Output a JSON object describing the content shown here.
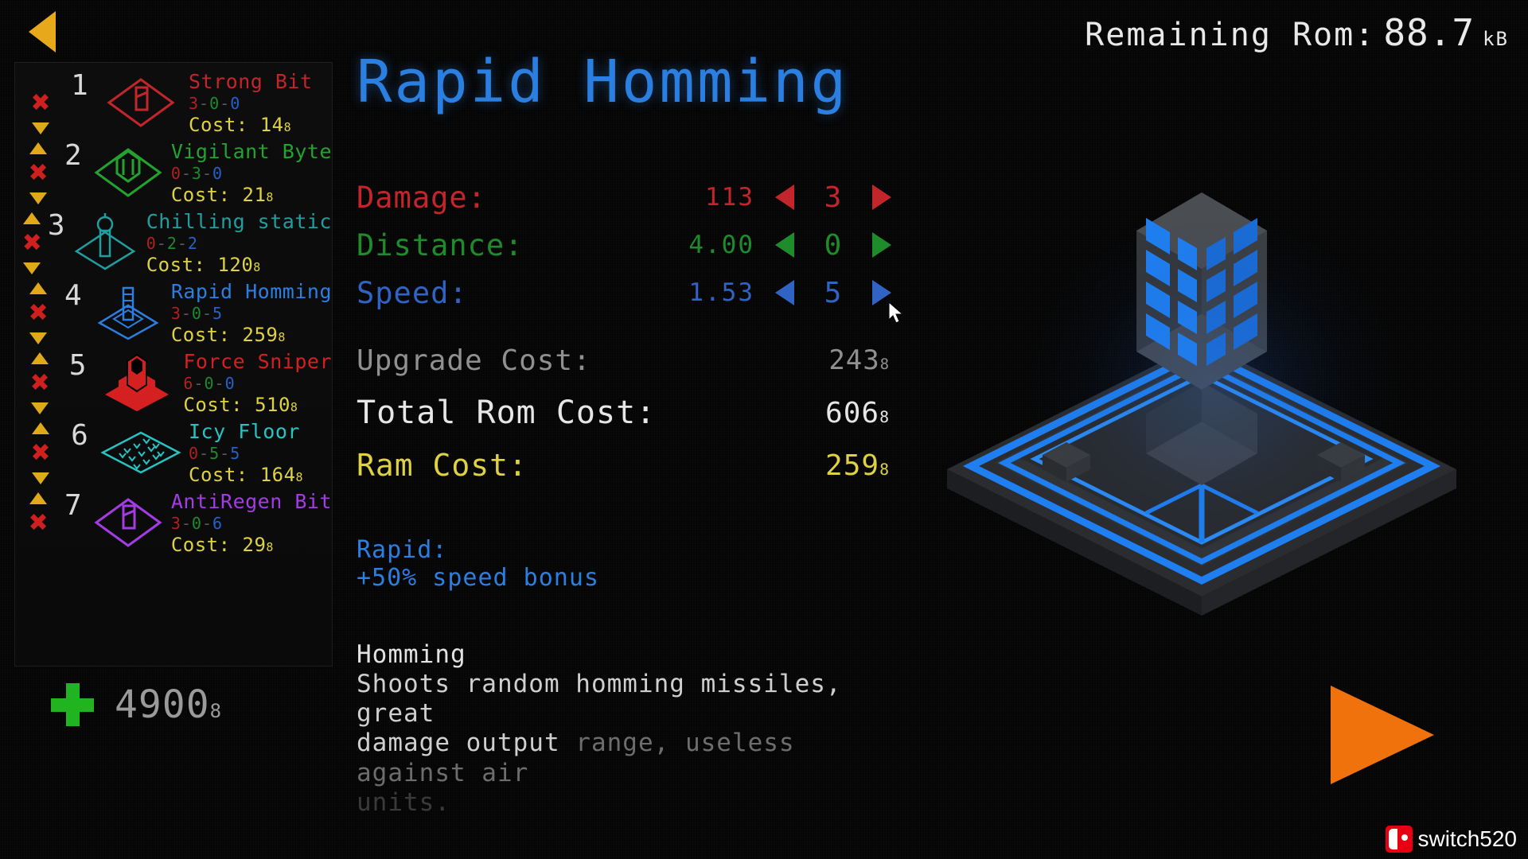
{
  "header": {
    "back_icon": "back-triangle-icon",
    "rom_label": "Remaining Rom:",
    "rom_value": "88.7",
    "rom_unit": "kB"
  },
  "sidebar": {
    "towers": [
      {
        "index": "1",
        "name": "Strong Bit",
        "color": "#c2262a",
        "dmg": "3",
        "rng": "0",
        "spd": "0",
        "cost": "14",
        "cost_sub": "8",
        "icon": "bit-diamond-icon"
      },
      {
        "index": "2",
        "name": "Vigilant Byte",
        "color": "#23a32e",
        "dmg": "0",
        "rng": "3",
        "spd": "0",
        "cost": "21",
        "cost_sub": "8",
        "icon": "byte-diamond-icon"
      },
      {
        "index": "3",
        "name": "Chilling static",
        "color": "#1f9f9f",
        "dmg": "0",
        "rng": "2",
        "spd": "2",
        "cost": "120",
        "cost_sub": "8",
        "icon": "static-tower-icon"
      },
      {
        "index": "4",
        "name": "Rapid Homming",
        "color": "#2b7fe0",
        "dmg": "3",
        "rng": "0",
        "spd": "5",
        "cost": "259",
        "cost_sub": "8",
        "icon": "homming-tower-icon"
      },
      {
        "index": "5",
        "name": "Force Sniper",
        "color": "#d42020",
        "dmg": "6",
        "rng": "0",
        "spd": "0",
        "cost": "510",
        "cost_sub": "8",
        "icon": "sniper-tower-icon"
      },
      {
        "index": "6",
        "name": "Icy Floor",
        "color": "#28c2c2",
        "dmg": "0",
        "rng": "5",
        "spd": "5",
        "cost": "164",
        "cost_sub": "8",
        "icon": "icy-floor-icon"
      },
      {
        "index": "7",
        "name": "AntiRegen Bit",
        "color": "#a43ce6",
        "dmg": "3",
        "rng": "0",
        "spd": "6",
        "cost": "29",
        "cost_sub": "8",
        "icon": "antiregen-diamond-icon"
      }
    ],
    "move_up_icon": "triangle-up-icon",
    "move_down_icon": "triangle-down-icon",
    "remove_icon": "x-close-icon",
    "total": {
      "add_icon": "plus-icon",
      "value": "4900",
      "sub": "8"
    }
  },
  "main": {
    "title": "Rapid Homming",
    "stats": [
      {
        "label": "Damage:",
        "value": "113",
        "level": "3",
        "color": "#c2262a",
        "dec_icon": "arrow-left-icon",
        "inc_icon": "arrow-right-icon"
      },
      {
        "label": "Distance:",
        "value": "4.00",
        "level": "0",
        "color": "#1e8c2a",
        "dec_icon": "arrow-left-icon",
        "inc_icon": "arrow-right-icon"
      },
      {
        "label": "Speed:",
        "value": "1.53",
        "level": "5",
        "color": "#2f63c4",
        "dec_icon": "arrow-left-icon",
        "inc_icon": "arrow-right-icon"
      }
    ],
    "costs": {
      "upgrade_label": "Upgrade Cost:",
      "upgrade_value": "243",
      "upgrade_sub": "8",
      "total_label": "Total Rom Cost:",
      "total_value": "606",
      "total_sub": "8",
      "ram_label": "Ram Cost:",
      "ram_value": "259",
      "ram_sub": "8"
    },
    "bonus": {
      "title": "Rapid:",
      "text": "+50% speed bonus"
    },
    "description": {
      "title": "Homming",
      "line1": "Shoots random homming missiles, great",
      "line2": "damage output",
      "line2_faded": " range, useless against air",
      "line3_faded": "units."
    }
  },
  "preview": {
    "model_icon": "isometric-tower-preview"
  },
  "footer": {
    "next_icon": "play-next-triangle-icon",
    "cursor_icon": "mouse-pointer-icon",
    "watermark_text": "switch520",
    "watermark_logo": "switch-logo-icon"
  },
  "colors": {
    "accent_blue": "#2b7fe0",
    "accent_orange": "#f0720c",
    "accent_yellow": "#ded243",
    "accent_green": "#1e8c2a",
    "accent_red": "#c2262a"
  }
}
